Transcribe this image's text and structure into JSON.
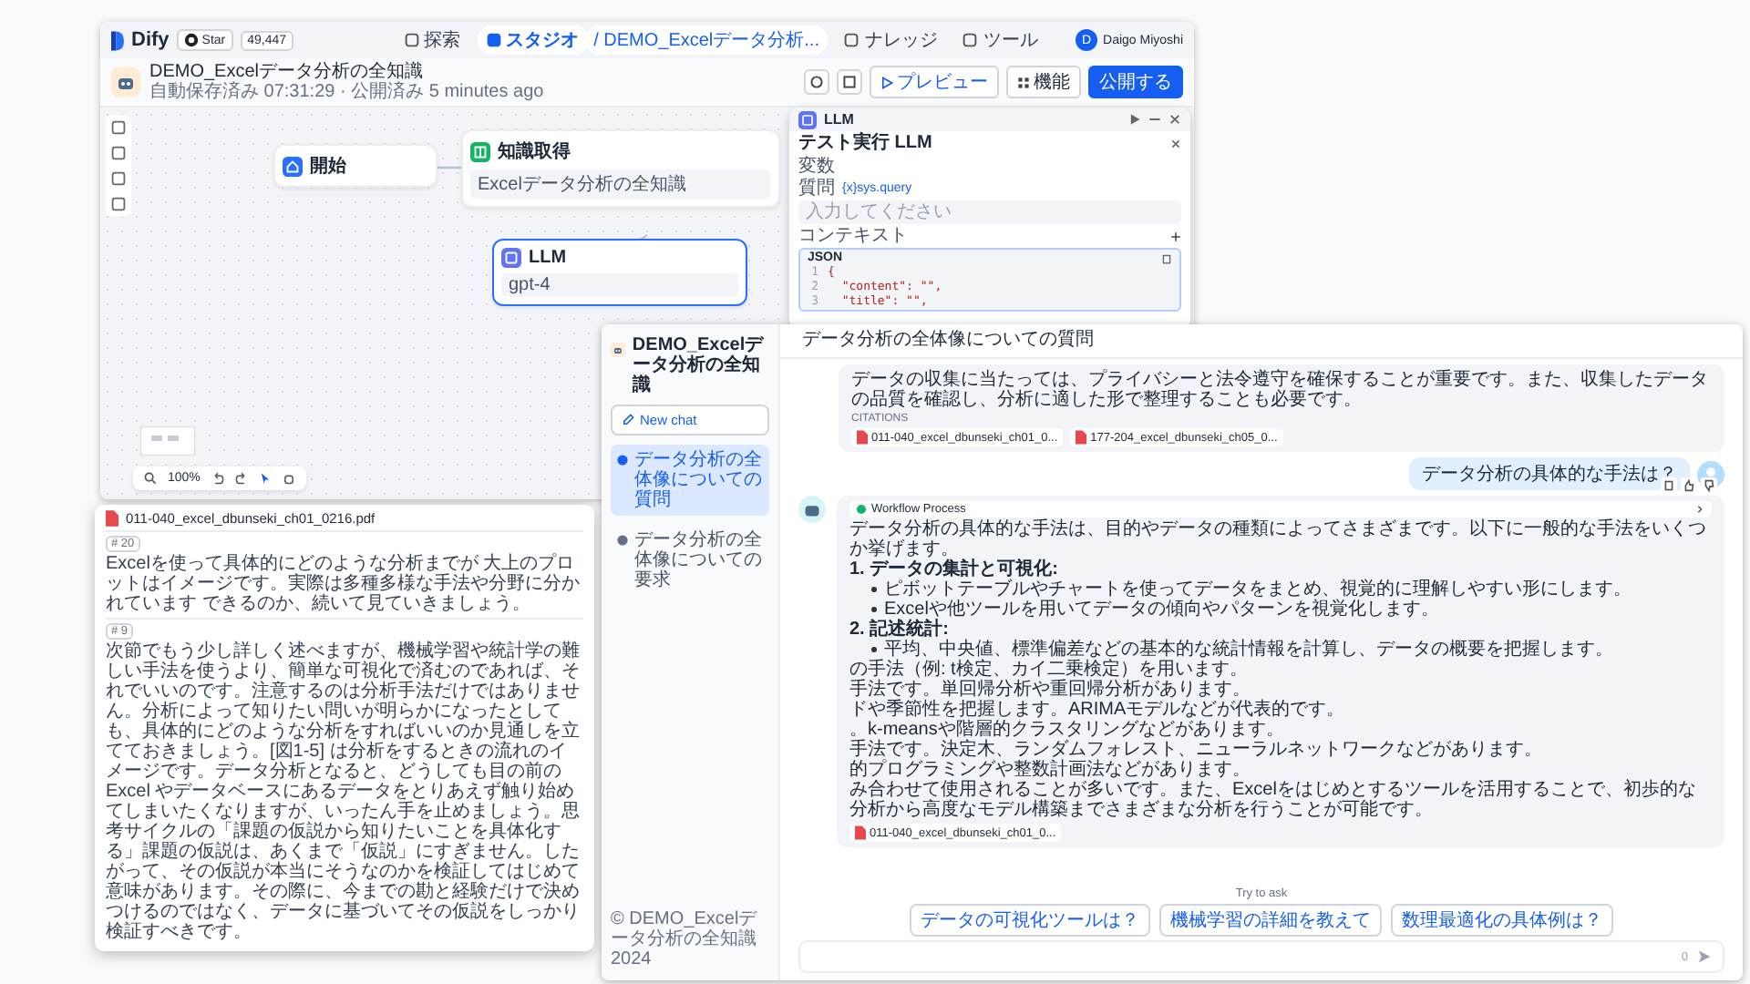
{
  "editor": {
    "brand": "Dify",
    "github": {
      "label": "Star",
      "count": "49,447"
    },
    "nav": [
      {
        "label": "探索",
        "selected": false
      },
      {
        "label": "スタジオ",
        "selected": true
      },
      {
        "label": "ナレッジ",
        "selected": false
      },
      {
        "label": "ツール",
        "selected": false
      }
    ],
    "breadcrumb_app": "/ DEMO_Excelデータ分析...",
    "user": {
      "name": "Daigo Miyoshi",
      "initial": "D"
    },
    "app_title": "DEMO_Excelデータ分析の全知識",
    "save_status": "自動保存済み 07:31:29 · 公開済み 5 minutes ago",
    "buttons": [
      {
        "label": "プレビュー",
        "kind": "preview"
      },
      {
        "label": "機能",
        "kind": "features"
      },
      {
        "label": "公開する",
        "kind": "publish"
      }
    ],
    "nodes": [
      {
        "title": "開始",
        "kind": "start",
        "color": "#2970ff",
        "selected": false
      },
      {
        "title": "知識取得",
        "kind": "retrieval",
        "color": "#16b364",
        "detail": "Excelデータ分析の全知識",
        "selected": false
      },
      {
        "title": "LLM",
        "kind": "llm",
        "color": "#6172f3",
        "detail": "gpt-4",
        "selected": true
      }
    ],
    "zoom": "100%",
    "panel": {
      "title": "LLM",
      "heading": "テスト実行 LLM",
      "section": "変数",
      "variable": {
        "label": "質問",
        "source": "{x}sys.query",
        "placeholder": "入力してください"
      },
      "context_label": "コンテキスト",
      "json_label": "JSON",
      "code": [
        {
          "number": "1",
          "text": "{"
        },
        {
          "number": "2",
          "text": "  \"content\": \"\","
        },
        {
          "number": "3",
          "text": "  \"title\": \"\","
        }
      ]
    }
  },
  "chat": {
    "app_name": "DEMO_Excelデータ分析の全知識",
    "new_chat": "New chat",
    "conversations": [
      {
        "title": "データ分析の全体像についての質問",
        "selected": true
      },
      {
        "title": "データ分析の全体像についての要求",
        "selected": false
      }
    ],
    "footer": "© DEMO_Excelデータ分析の全知識 2024",
    "header": "データ分析の全体像についての質問",
    "previous_answer": {
      "text": "データの収集に当たっては、プライバシーと法令遵守を確保することが重要です。また、収集したデータの品質を確認し、分析に適した形で整理することも必要です。",
      "citations_label": "CITATIONS",
      "citations": [
        "011-040_excel_dbunseki_ch01_0...",
        "177-204_excel_dbunseki_ch05_0..."
      ]
    },
    "question": "データ分析の具体的な手法は？",
    "answer": {
      "workflow": "Workflow Process",
      "blocks": [
        {
          "kind": "paragraph",
          "text": "データ分析の具体的な手法は、目的やデータの種類によってさまざまです。以下に一般的な手法をいくつか挙げます。"
        },
        {
          "kind": "heading",
          "text": "1. データの集計と可視化:"
        },
        {
          "kind": "bullet",
          "text": "ピボットテーブルやチャートを使ってデータをまとめ、視覚的に理解しやすい形にします。"
        },
        {
          "kind": "bullet",
          "text": "Excelや他ツールを用いてデータの傾向やパターンを視覚化します。"
        },
        {
          "kind": "heading",
          "text": "2. 記述統計:"
        },
        {
          "kind": "bullet",
          "text": "平均、中央値、標準偏差などの基本的な統計情報を計算し、データの概要を把握します。"
        },
        {
          "kind": "line",
          "text": "の手法（例: t検定、カイ二乗検定）を用います。"
        },
        {
          "kind": "line",
          "text": "手法です。単回帰分析や重回帰分析があります。"
        },
        {
          "kind": "line",
          "text": "ドや季節性を把握します。ARIMAモデルなどが代表的です。"
        },
        {
          "kind": "line",
          "text": "。k-meansや階層的クラスタリングなどがあります。"
        },
        {
          "kind": "line",
          "text": "手法です。決定木、ランダムフォレスト、ニューラルネットワークなどがあります。"
        },
        {
          "kind": "line",
          "text": "的プログラミングや整数計画法などがあります。"
        },
        {
          "kind": "line",
          "text": "み合わせて使用されることが多いです。また、Excelをはじめとするツールを活用することで、初歩的な分析から高度なモデル構築までさまざまな分析を行うことが可能です。"
        }
      ],
      "citations": [
        "011-040_excel_dbunseki_ch01_0..."
      ]
    },
    "popup": {
      "file": "011-040_excel_dbunseki_ch01_0216.pdf",
      "chunks": [
        {
          "badge": "# 20",
          "text": "Excelを使って具体的にどのような分析までが 大上のプロットはイメージです。実際は多種多様な手法や分野に分かれています できるのか、続いて見ていきましょう。"
        },
        {
          "badge": "# 9",
          "text": "次節でもう少し詳しく述べますが、機械学習や統計学の難しい手法を使うより、簡単な可視化で済むのであれば、それでいいのです。注意するのは分析手法だけではありません。分析によって知りたい問いが明らかになったとしても、具体的にどのような分析をすればいいのか見通しを立てておきましょう。[図1-5] は分析をするときの流れのイメージです。データ分析となると、どうしても目の前の Excel やデータベースにあるデータをとりあえず触り始めてしまいたくなりますが、いったん手を止めましょう。思考サイクルの「課題の仮説から知りたいことを具体化する」課題の仮説は、あくまで「仮説」にすぎません。したがって、その仮説が本当にそうなのかを検証してはじめて意味があります。その際に、今までの勘と経験だけで決めつけるのではなく、データに基づいてその仮説をしっかり検証すべきです。"
        }
      ]
    },
    "try_to_ask": "Try to ask",
    "suggestions": [
      "データの可視化ツールは？",
      "機械学習の詳細を教えて",
      "数理最適化の具体例は？"
    ],
    "input_counter": "0"
  }
}
